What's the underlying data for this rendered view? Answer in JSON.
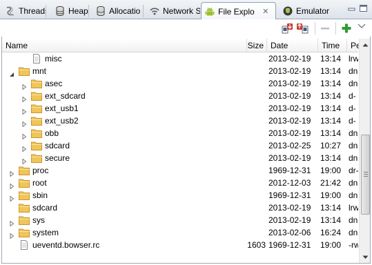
{
  "tabs": [
    {
      "label": "Threads",
      "icon": "threads-icon",
      "active": false
    },
    {
      "label": "Heap",
      "icon": "heap-icon",
      "active": false
    },
    {
      "label": "Allocatio",
      "icon": "allocation-icon",
      "active": false
    },
    {
      "label": "Network S",
      "icon": "network-icon",
      "active": false
    },
    {
      "label": "File Explo",
      "icon": "android-icon",
      "active": true,
      "close": "✕"
    },
    {
      "label": "Emulator",
      "icon": "emulator-icon",
      "active": false
    }
  ],
  "toolbar": {
    "buttons": [
      "pull-file-icon",
      "push-file-icon",
      "delete-icon",
      "new-folder-icon"
    ],
    "view_menu_icon": "chevron-down-icon"
  },
  "table": {
    "columns": [
      "Name",
      "Size",
      "Date",
      "Time",
      "Pe"
    ],
    "rows": [
      {
        "name": "misc",
        "level": 1,
        "kind": "file",
        "expand": "",
        "size": "",
        "date": "2013-02-19",
        "time": "13:14",
        "perm": "lrw"
      },
      {
        "name": "mnt",
        "level": 0,
        "kind": "folder",
        "expand": "open",
        "size": "",
        "date": "2013-02-19",
        "time": "13:14",
        "perm": "dn"
      },
      {
        "name": "asec",
        "level": 1,
        "kind": "folder",
        "expand": "closed",
        "size": "",
        "date": "2013-02-19",
        "time": "13:14",
        "perm": "dn"
      },
      {
        "name": "ext_sdcard",
        "level": 1,
        "kind": "folder",
        "expand": "closed",
        "size": "",
        "date": "2013-02-19",
        "time": "13:14",
        "perm": "d-"
      },
      {
        "name": "ext_usb1",
        "level": 1,
        "kind": "folder",
        "expand": "closed",
        "size": "",
        "date": "2013-02-19",
        "time": "13:14",
        "perm": "d-"
      },
      {
        "name": "ext_usb2",
        "level": 1,
        "kind": "folder",
        "expand": "closed",
        "size": "",
        "date": "2013-02-19",
        "time": "13:14",
        "perm": "d-"
      },
      {
        "name": "obb",
        "level": 1,
        "kind": "folder",
        "expand": "closed",
        "size": "",
        "date": "2013-02-19",
        "time": "13:14",
        "perm": "dn"
      },
      {
        "name": "sdcard",
        "level": 1,
        "kind": "folder",
        "expand": "closed",
        "size": "",
        "date": "2013-02-25",
        "time": "10:27",
        "perm": "dn"
      },
      {
        "name": "secure",
        "level": 1,
        "kind": "folder",
        "expand": "closed",
        "size": "",
        "date": "2013-02-19",
        "time": "13:14",
        "perm": "dn"
      },
      {
        "name": "proc",
        "level": 0,
        "kind": "folder",
        "expand": "closed",
        "size": "",
        "date": "1969-12-31",
        "time": "19:00",
        "perm": "dr-"
      },
      {
        "name": "root",
        "level": 0,
        "kind": "folder",
        "expand": "closed",
        "size": "",
        "date": "2012-12-03",
        "time": "21:42",
        "perm": "dn"
      },
      {
        "name": "sbin",
        "level": 0,
        "kind": "folder",
        "expand": "closed",
        "size": "",
        "date": "1969-12-31",
        "time": "19:00",
        "perm": "dn"
      },
      {
        "name": "sdcard",
        "level": 0,
        "kind": "folder",
        "expand": "",
        "size": "",
        "date": "2013-02-19",
        "time": "13:14",
        "perm": "lrw"
      },
      {
        "name": "sys",
        "level": 0,
        "kind": "folder",
        "expand": "closed",
        "size": "",
        "date": "2013-02-19",
        "time": "13:14",
        "perm": "dn"
      },
      {
        "name": "system",
        "level": 0,
        "kind": "folder",
        "expand": "closed",
        "size": "",
        "date": "2013-02-06",
        "time": "16:24",
        "perm": "dn"
      },
      {
        "name": "ueventd.bowser.rc",
        "level": 0,
        "kind": "file",
        "expand": "",
        "size": "1603",
        "date": "1969-12-31",
        "time": "19:00",
        "perm": "-rw"
      }
    ]
  },
  "scroll": {
    "position": 0.7
  }
}
